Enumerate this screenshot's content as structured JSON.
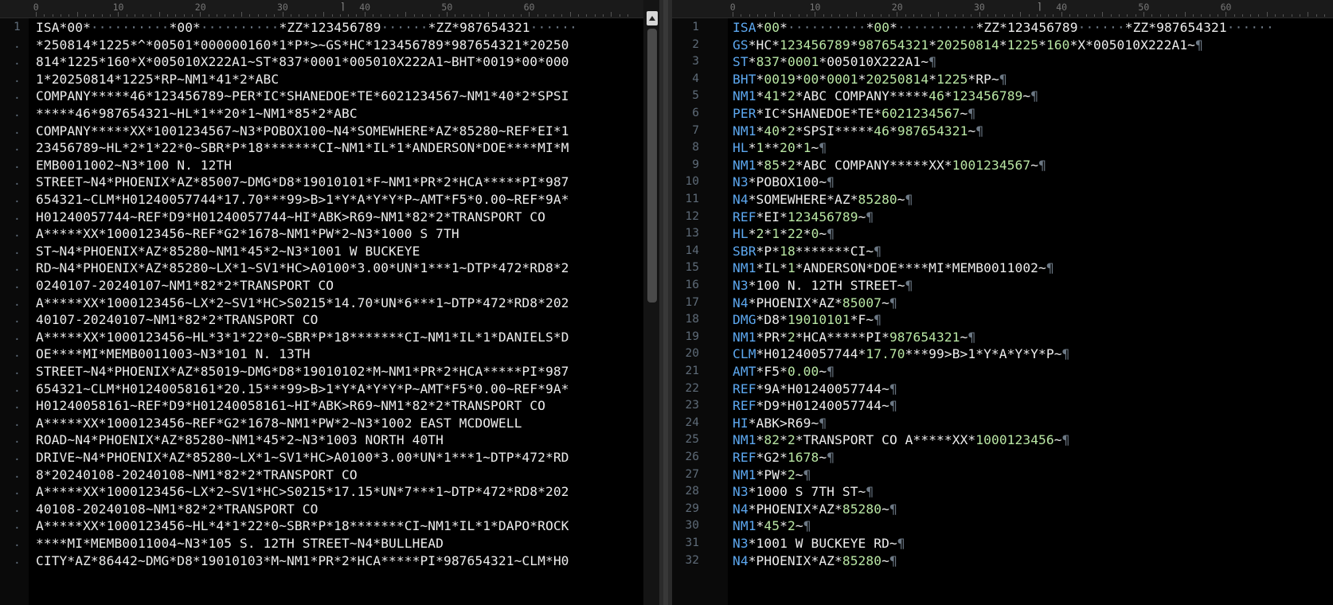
{
  "ruler": {
    "marks": [
      "0",
      "10",
      "20",
      "30",
      "40",
      "50",
      "60"
    ]
  },
  "left_editor": {
    "line_numbers": [
      "1",
      ".",
      ".",
      ".",
      ".",
      ".",
      ".",
      ".",
      ".",
      ".",
      ".",
      ".",
      ".",
      ".",
      ".",
      ".",
      ".",
      ".",
      ".",
      ".",
      ".",
      ".",
      ".",
      ".",
      ".",
      ".",
      ".",
      ".",
      ".",
      ".",
      ".",
      "."
    ],
    "lines": [
      "ISA*00*··········*00*··········*ZZ*123456789······*ZZ*987654321······",
      "*250814*1225*^*00501*000000160*1*P*>~GS*HC*123456789*987654321*20250",
      "814*1225*160*X*005010X222A1~ST*837*0001*005010X222A1~BHT*0019*00*000",
      "1*20250814*1225*RP~NM1*41*2*ABC",
      "COMPANY*****46*123456789~PER*IC*SHANEDOE*TE*6021234567~NM1*40*2*SPSI",
      "*****46*987654321~HL*1**20*1~NM1*85*2*ABC",
      "COMPANY*****XX*1001234567~N3*POBOX100~N4*SOMEWHERE*AZ*85280~REF*EI*1",
      "23456789~HL*2*1*22*0~SBR*P*18*******CI~NM1*IL*1*ANDERSON*DOE****MI*M",
      "EMB0011002~N3*100 N. 12TH",
      "STREET~N4*PHOENIX*AZ*85007~DMG*D8*19010101*F~NM1*PR*2*HCA*****PI*987",
      "654321~CLM*H01240057744*17.70***99>B>1*Y*A*Y*Y*P~AMT*F5*0.00~REF*9A*",
      "H01240057744~REF*D9*H01240057744~HI*ABK>R69~NM1*82*2*TRANSPORT CO",
      "A*****XX*1000123456~REF*G2*1678~NM1*PW*2~N3*1000 S 7TH",
      "ST~N4*PHOENIX*AZ*85280~NM1*45*2~N3*1001 W BUCKEYE",
      "RD~N4*PHOENIX*AZ*85280~LX*1~SV1*HC>A0100*3.00*UN*1***1~DTP*472*RD8*2",
      "0240107-20240107~NM1*82*2*TRANSPORT CO",
      "A*****XX*1000123456~LX*2~SV1*HC>S0215*14.70*UN*6***1~DTP*472*RD8*202",
      "40107-20240107~NM1*82*2*TRANSPORT CO",
      "A*****XX*1000123456~HL*3*1*22*0~SBR*P*18*******CI~NM1*IL*1*DANIELS*D",
      "OE****MI*MEMB0011003~N3*101 N. 13TH",
      "STREET~N4*PHOENIX*AZ*85019~DMG*D8*19010102*M~NM1*PR*2*HCA*****PI*987",
      "654321~CLM*H01240058161*20.15***99>B>1*Y*A*Y*Y*P~AMT*F5*0.00~REF*9A*",
      "H01240058161~REF*D9*H01240058161~HI*ABK>R69~NM1*82*2*TRANSPORT CO",
      "A*****XX*1000123456~REF*G2*1678~NM1*PW*2~N3*1002 EAST MCDOWELL",
      "ROAD~N4*PHOENIX*AZ*85280~NM1*45*2~N3*1003 NORTH 40TH",
      "DRIVE~N4*PHOENIX*AZ*85280~LX*1~SV1*HC>A0100*3.00*UN*1***1~DTP*472*RD",
      "8*20240108-20240108~NM1*82*2*TRANSPORT CO",
      "A*****XX*1000123456~LX*2~SV1*HC>S0215*17.15*UN*7***1~DTP*472*RD8*202",
      "40108-20240108~NM1*82*2*TRANSPORT CO",
      "A*****XX*1000123456~HL*4*1*22*0~SBR*P*18*******CI~NM1*IL*1*DAPO*ROCK",
      "****MI*MEMB0011004~N3*105 S. 12TH STREET~N4*BULLHEAD",
      "CITY*AZ*86442~DMG*D8*19010103*M~NM1*PR*2*HCA*****PI*987654321~CLM*H0"
    ]
  },
  "right_editor": {
    "line_numbers": [
      "1",
      "2",
      "3",
      "4",
      "5",
      "6",
      "7",
      "8",
      "9",
      "10",
      "11",
      "12",
      "13",
      "14",
      "15",
      "16",
      "17",
      "18",
      "19",
      "20",
      "21",
      "22",
      "23",
      "24",
      "25",
      "26",
      "27",
      "28",
      "29",
      "30",
      "31",
      "32"
    ],
    "lines": [
      "ISA*00*··········*00*··········*ZZ*123456789······*ZZ*987654321······",
      "GS*HC*123456789*987654321*20250814*1225*160*X*005010X222A1~¶",
      "ST*837*0001*005010X222A1~¶",
      "BHT*0019*00*0001*20250814*1225*RP~¶",
      "NM1*41*2*ABC COMPANY*****46*123456789~¶",
      "PER*IC*SHANEDOE*TE*6021234567~¶",
      "NM1*40*2*SPSI*****46*987654321~¶",
      "HL*1**20*1~¶",
      "NM1*85*2*ABC COMPANY*****XX*1001234567~¶",
      "N3*POBOX100~¶",
      "N4*SOMEWHERE*AZ*85280~¶",
      "REF*EI*123456789~¶",
      "HL*2*1*22*0~¶",
      "SBR*P*18*******CI~¶",
      "NM1*IL*1*ANDERSON*DOE****MI*MEMB0011002~¶",
      "N3*100 N. 12TH STREET~¶",
      "N4*PHOENIX*AZ*85007~¶",
      "DMG*D8*19010101*F~¶",
      "NM1*PR*2*HCA*****PI*987654321~¶",
      "CLM*H01240057744*17.70***99>B>1*Y*A*Y*Y*P~¶",
      "AMT*F5*0.00~¶",
      "REF*9A*H01240057744~¶",
      "REF*D9*H01240057744~¶",
      "HI*ABK>R69~¶",
      "NM1*82*2*TRANSPORT CO A*****XX*1000123456~¶",
      "REF*G2*1678~¶",
      "NM1*PW*2~¶",
      "N3*1000 S 7TH ST~¶",
      "N4*PHOENIX*AZ*85280~¶",
      "NM1*45*2~¶",
      "N3*1001 W BUCKEYE RD~¶",
      "N4*PHOENIX*AZ*85280~¶"
    ]
  }
}
